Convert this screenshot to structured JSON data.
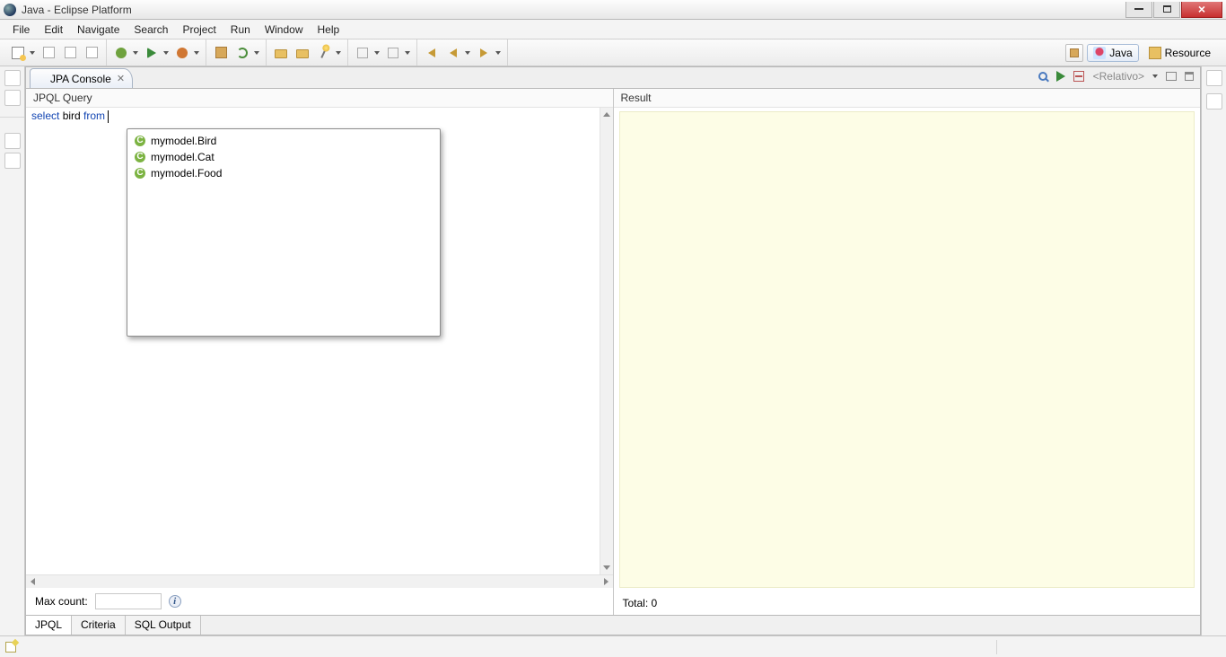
{
  "window": {
    "title": "Java - Eclipse Platform"
  },
  "menu": {
    "items": [
      "File",
      "Edit",
      "Navigate",
      "Search",
      "Project",
      "Run",
      "Window",
      "Help"
    ]
  },
  "perspectives": {
    "java": "Java",
    "resource": "Resource"
  },
  "view": {
    "tab_title": "JPA Console",
    "relativo_label": "<Relativo>",
    "query_header": "JPQL Query",
    "result_header": "Result",
    "query_select_kw": "select",
    "query_ident": " bird ",
    "query_from_kw": "from",
    "query_after": " ",
    "max_count_label": "Max count:",
    "max_count_value": "",
    "total_label": "Total: 0"
  },
  "autocomplete": {
    "items": [
      "mymodel.Bird",
      "mymodel.Cat",
      "mymodel.Food"
    ]
  },
  "bottom_tabs": {
    "items": [
      "JPQL",
      "Criteria",
      "SQL Output"
    ]
  },
  "icons": {
    "info_glyph": "i",
    "entity_glyph": "C"
  }
}
